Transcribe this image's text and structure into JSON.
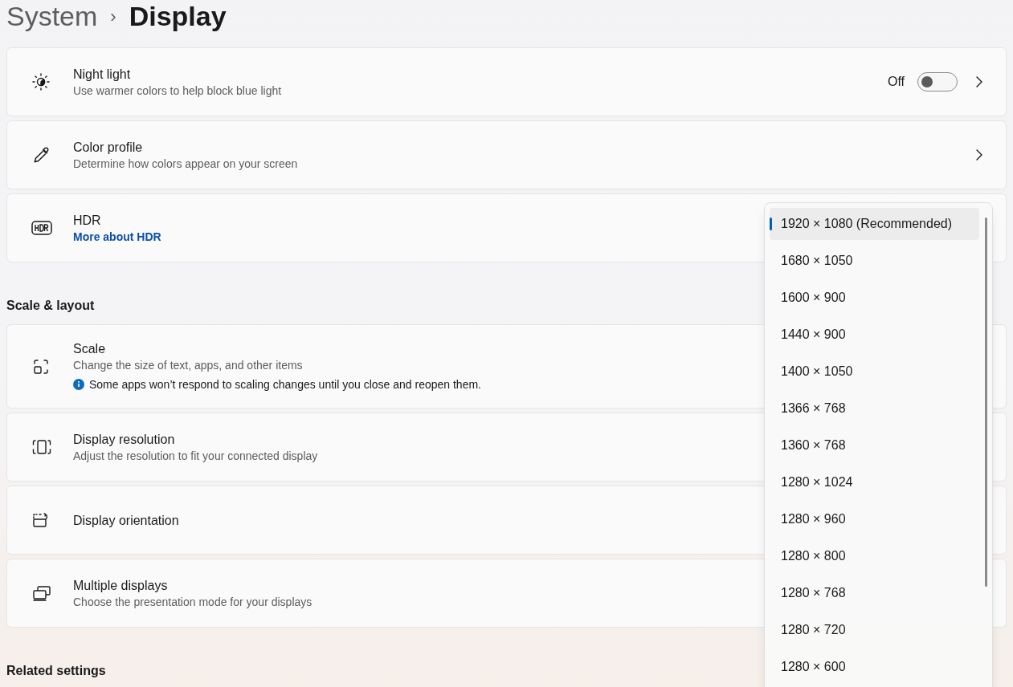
{
  "breadcrumb": {
    "parent": "System",
    "separator": "›",
    "current": "Display"
  },
  "sections": [
    {
      "cards": [
        {
          "kind": "toggle",
          "title": "Night light",
          "subtitle": "Use warmer colors to help block blue light",
          "toggle_label": "Off",
          "on": false
        },
        {
          "kind": "chevron",
          "title": "Color profile",
          "subtitle": "Determine how colors appear on your screen"
        },
        {
          "kind": "link",
          "title": "HDR",
          "link": "More about HDR"
        }
      ]
    },
    {
      "heading": "Scale & layout",
      "cards": [
        {
          "kind": "info",
          "title": "Scale",
          "subtitle": "Change the size of text, apps, and other items",
          "info": "Some apps won’t respond to scaling changes until you close and reopen them."
        },
        {
          "kind": "plain",
          "title": "Display resolution",
          "subtitle": "Adjust the resolution to fit your connected display"
        },
        {
          "kind": "plain",
          "title": "Display orientation"
        },
        {
          "kind": "plain",
          "title": "Multiple displays",
          "subtitle": "Choose the presentation mode for your displays"
        }
      ]
    },
    {
      "heading": "Related settings"
    }
  ],
  "dropdown": {
    "options": [
      {
        "label": "1920 × 1080 (Recommended)",
        "selected": true
      },
      {
        "label": "1680 × 1050",
        "selected": false
      },
      {
        "label": "1600 × 900",
        "selected": false
      },
      {
        "label": "1440 × 900",
        "selected": false
      },
      {
        "label": "1400 × 1050",
        "selected": false
      },
      {
        "label": "1366 × 768",
        "selected": false
      },
      {
        "label": "1360 × 768",
        "selected": false
      },
      {
        "label": "1280 × 1024",
        "selected": false
      },
      {
        "label": "1280 × 960",
        "selected": false
      },
      {
        "label": "1280 × 800",
        "selected": false
      },
      {
        "label": "1280 × 768",
        "selected": false
      },
      {
        "label": "1280 × 720",
        "selected": false
      },
      {
        "label": "1280 × 600",
        "selected": false
      }
    ]
  }
}
